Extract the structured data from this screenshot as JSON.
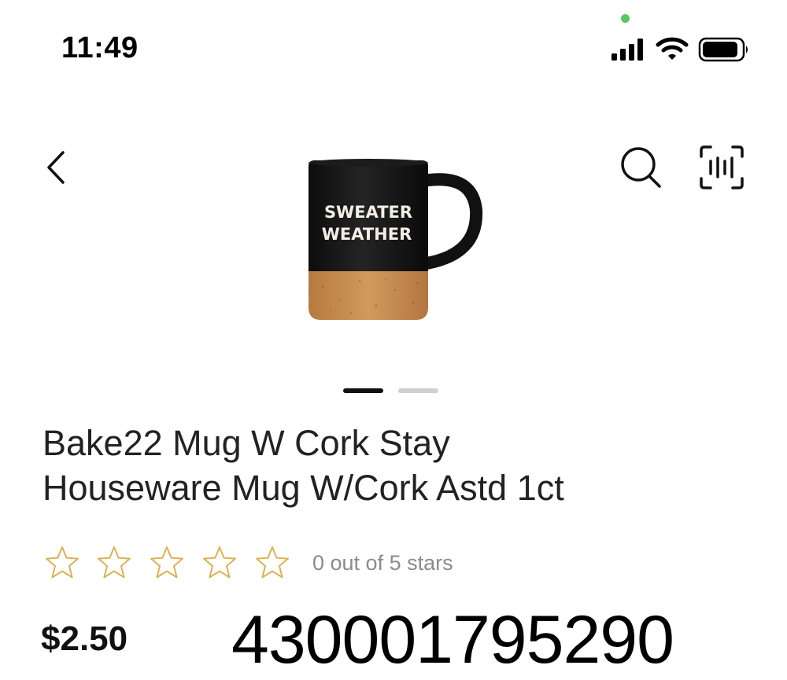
{
  "status_bar": {
    "time": "11:49",
    "icons": [
      "privacy-dot",
      "cellular-signal-icon",
      "wifi-icon",
      "battery-icon"
    ]
  },
  "header": {
    "icons": [
      "back-chevron-icon",
      "search-icon",
      "barcode-scan-icon"
    ]
  },
  "product": {
    "image": {
      "icon": "mug-product-image",
      "print_line_1": "SWEATER",
      "print_line_2": "WEATHER"
    },
    "carousel": {
      "count": 2,
      "active_index": 0
    },
    "title_line_1": "Bake22 Mug W Cork Stay",
    "title_line_2": "Houseware Mug W/Cork Astd 1ct",
    "rating": {
      "value": 0,
      "max": 5,
      "text": "0 out of 5 stars"
    },
    "price": "$2.50",
    "upc": "430001795290"
  },
  "colors": {
    "star_outline": "#d8b25a",
    "rating_text": "#8b8b8b",
    "privacy_dot": "#5ac763",
    "carousel_active": "#111111",
    "carousel_inactive": "#cfcfcf",
    "mug_body": "#141414",
    "mug_cork": "#c98b4e"
  }
}
